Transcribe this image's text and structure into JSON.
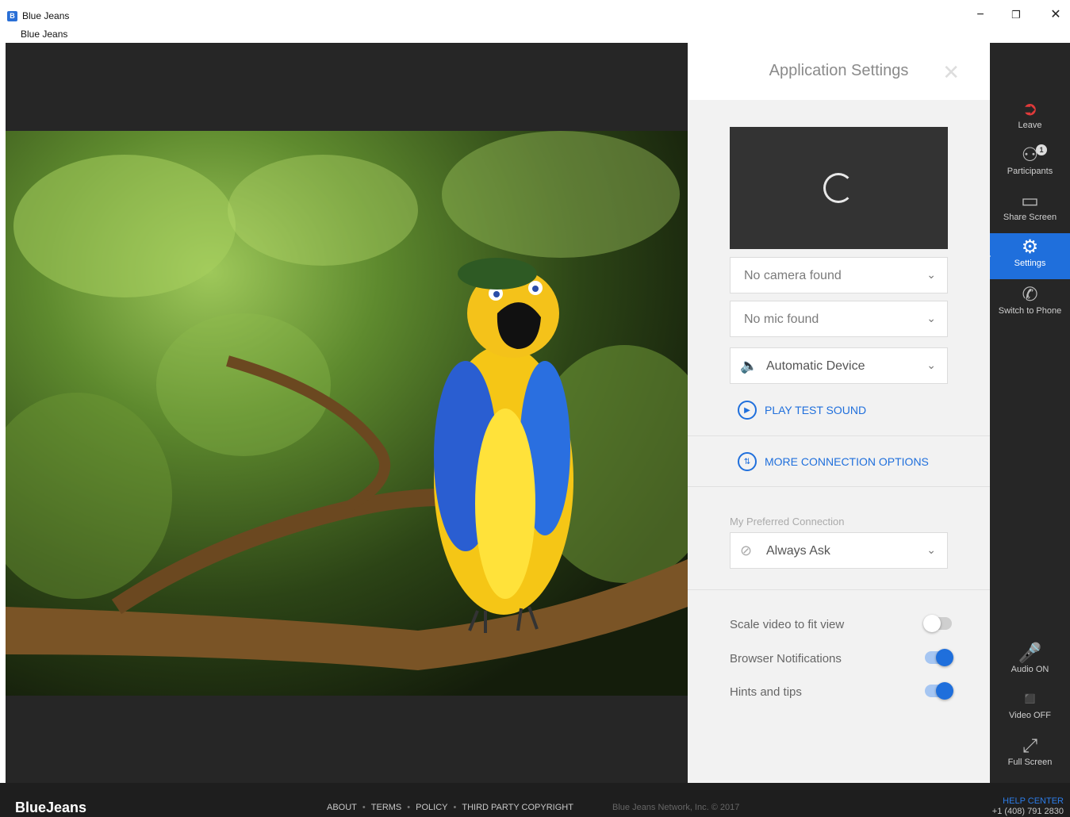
{
  "window": {
    "title": "Blue Jeans",
    "menu_label": "Blue Jeans",
    "icon_letter": "B",
    "minimize": "−",
    "restore": "❐",
    "close": "✕"
  },
  "panel": {
    "title": "Application Settings",
    "close_glyph": "✕",
    "camera_select": "No camera found",
    "mic_select": "No mic found",
    "speaker_select": "Automatic Device",
    "play_test_sound": "PLAY TEST SOUND",
    "more_connection_options": "MORE CONNECTION OPTIONS",
    "preferred_connection_label": "My Preferred Connection",
    "preferred_connection_value": "Always Ask",
    "toggles": [
      {
        "label": "Scale video to fit view",
        "on": false
      },
      {
        "label": "Browser Notifications",
        "on": true
      },
      {
        "label": "Hints and tips",
        "on": true
      }
    ]
  },
  "nav": {
    "leave": "Leave",
    "participants": "Participants",
    "participants_count": "1",
    "share_screen": "Share Screen",
    "settings": "Settings",
    "switch_to_phone": "Switch to Phone",
    "audio": "Audio ON",
    "video": "Video OFF",
    "full_screen": "Full Screen"
  },
  "footer": {
    "brand": "BlueJeans",
    "links": [
      "ABOUT",
      "TERMS",
      "POLICY",
      "THIRD PARTY COPYRIGHT"
    ],
    "copyright": "Blue Jeans Network, Inc. © 2017",
    "help_center": "HELP CENTER",
    "phone": "+1 (408) 791 2830"
  },
  "colors": {
    "accent": "#1f6fdc",
    "leave": "#e03a3a",
    "panel_bg": "#f2f2f2",
    "app_bg": "#262626"
  }
}
